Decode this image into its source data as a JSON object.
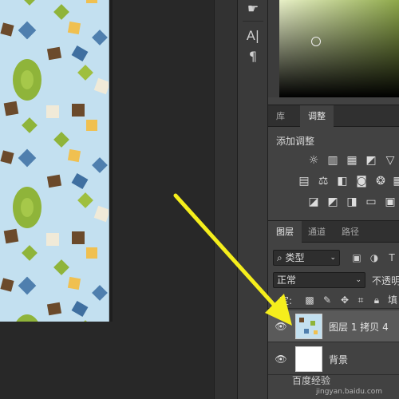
{
  "toolbar": {
    "tools": [
      {
        "icon": "hand-pointer-icon"
      },
      {
        "icon": "character-panel-icon",
        "glyph": "A|"
      },
      {
        "icon": "paragraph-panel-icon",
        "glyph": "¶"
      }
    ]
  },
  "adjust_panel": {
    "tabs": [
      {
        "label": "库",
        "active": false
      },
      {
        "label": "调整",
        "active": true
      }
    ],
    "title": "添加调整",
    "icons": [
      "brightness-contrast-icon",
      "levels-icon",
      "curves-icon",
      "exposure-icon",
      "vibrance-triangle-icon",
      "color-lookup-grid-icon",
      "color-balance-icon",
      "black-white-icon",
      "photo-filter-icon",
      "channel-mixer-icon",
      "color-table-icon",
      "invert-icon",
      "posterize-icon",
      "threshold-icon",
      "gradient-map-icon",
      "selective-color-icon"
    ]
  },
  "layers_panel": {
    "tabs": [
      {
        "label": "图层",
        "active": true
      },
      {
        "label": "通道",
        "active": false
      },
      {
        "label": "路径",
        "active": false
      }
    ],
    "filter_kind": "类型",
    "filter_icons": [
      "image-filter-icon",
      "adjustment-filter-icon",
      "type-filter-icon"
    ],
    "blend_mode": "正常",
    "opacity_label": "不透明",
    "lock_label": "定:",
    "lock_icons": [
      "lock-transparent-icon",
      "lock-paint-icon",
      "lock-move-icon",
      "lock-artboard-icon",
      "lock-all-icon"
    ],
    "lock_trailing": "填",
    "layers": [
      {
        "name": "图层 1 拷贝 4",
        "visible": true,
        "selected": true,
        "thumb": "pattern"
      },
      {
        "name": "背景",
        "visible": true,
        "selected": false,
        "thumb": "white"
      }
    ]
  },
  "watermark": {
    "text": "百度经验",
    "sub": "jingyan.baidu.com"
  },
  "colors": {
    "annotation_arrow": "#f5ee1c",
    "panel_bg": "#424242",
    "selected_layer": "#5a5a5a"
  }
}
